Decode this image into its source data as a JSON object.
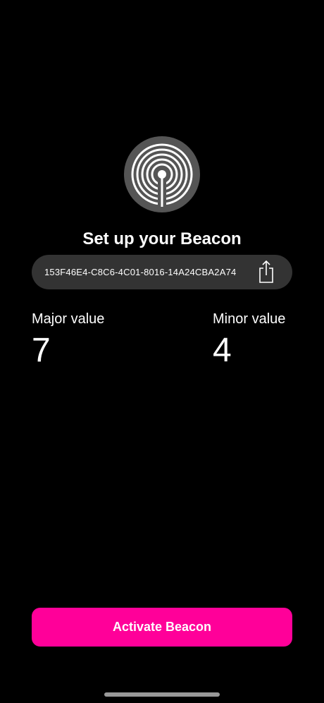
{
  "colors": {
    "background": "#000000",
    "logo_circle": "#555555",
    "pill": "#333333",
    "accent": "#FF0099",
    "text": "#FFFFFF"
  },
  "header": {
    "logo_icon": "beacon-broadcast-icon",
    "title": "Set up your Beacon"
  },
  "uuid": {
    "value": "153F46E4-C8C6-4C01-8016-14A24CBA2A74",
    "share_icon": "share-icon"
  },
  "values": {
    "major": {
      "label": "Major value",
      "value": "7"
    },
    "minor": {
      "label": "Minor value",
      "value": "4"
    }
  },
  "actions": {
    "activate_label": "Activate Beacon"
  }
}
